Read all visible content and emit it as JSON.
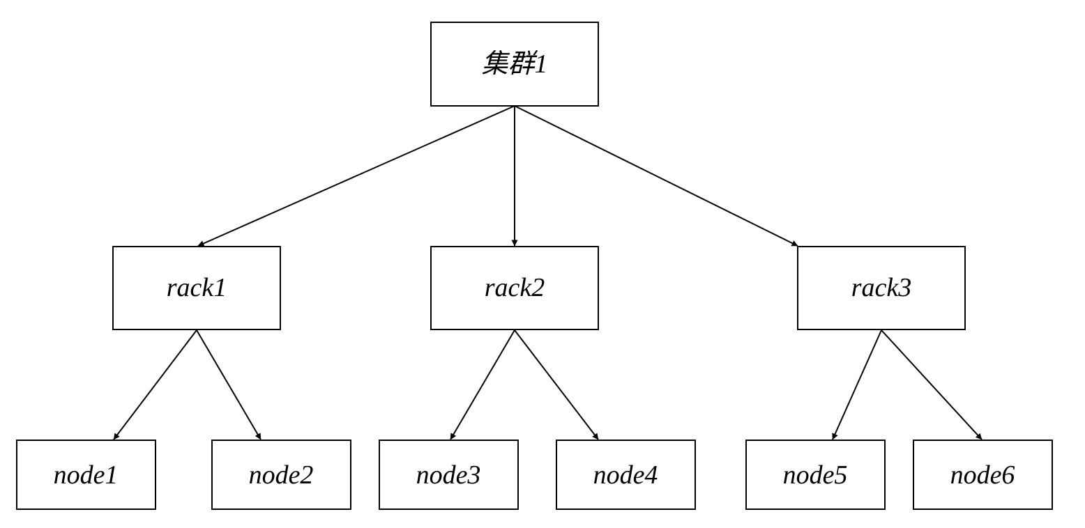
{
  "nodes": {
    "cluster": "集群1",
    "rack1": "rack1",
    "rack2": "rack2",
    "rack3": "rack3",
    "node1": "node1",
    "node2": "node2",
    "node3": "node3",
    "node4": "node4",
    "node5": "node5",
    "node6": "node6"
  },
  "edges": [
    [
      "cluster",
      "rack1"
    ],
    [
      "cluster",
      "rack2"
    ],
    [
      "cluster",
      "rack3"
    ],
    [
      "rack1",
      "node1"
    ],
    [
      "rack1",
      "node2"
    ],
    [
      "rack2",
      "node3"
    ],
    [
      "rack2",
      "node4"
    ],
    [
      "rack3",
      "node5"
    ],
    [
      "rack3",
      "node6"
    ]
  ]
}
